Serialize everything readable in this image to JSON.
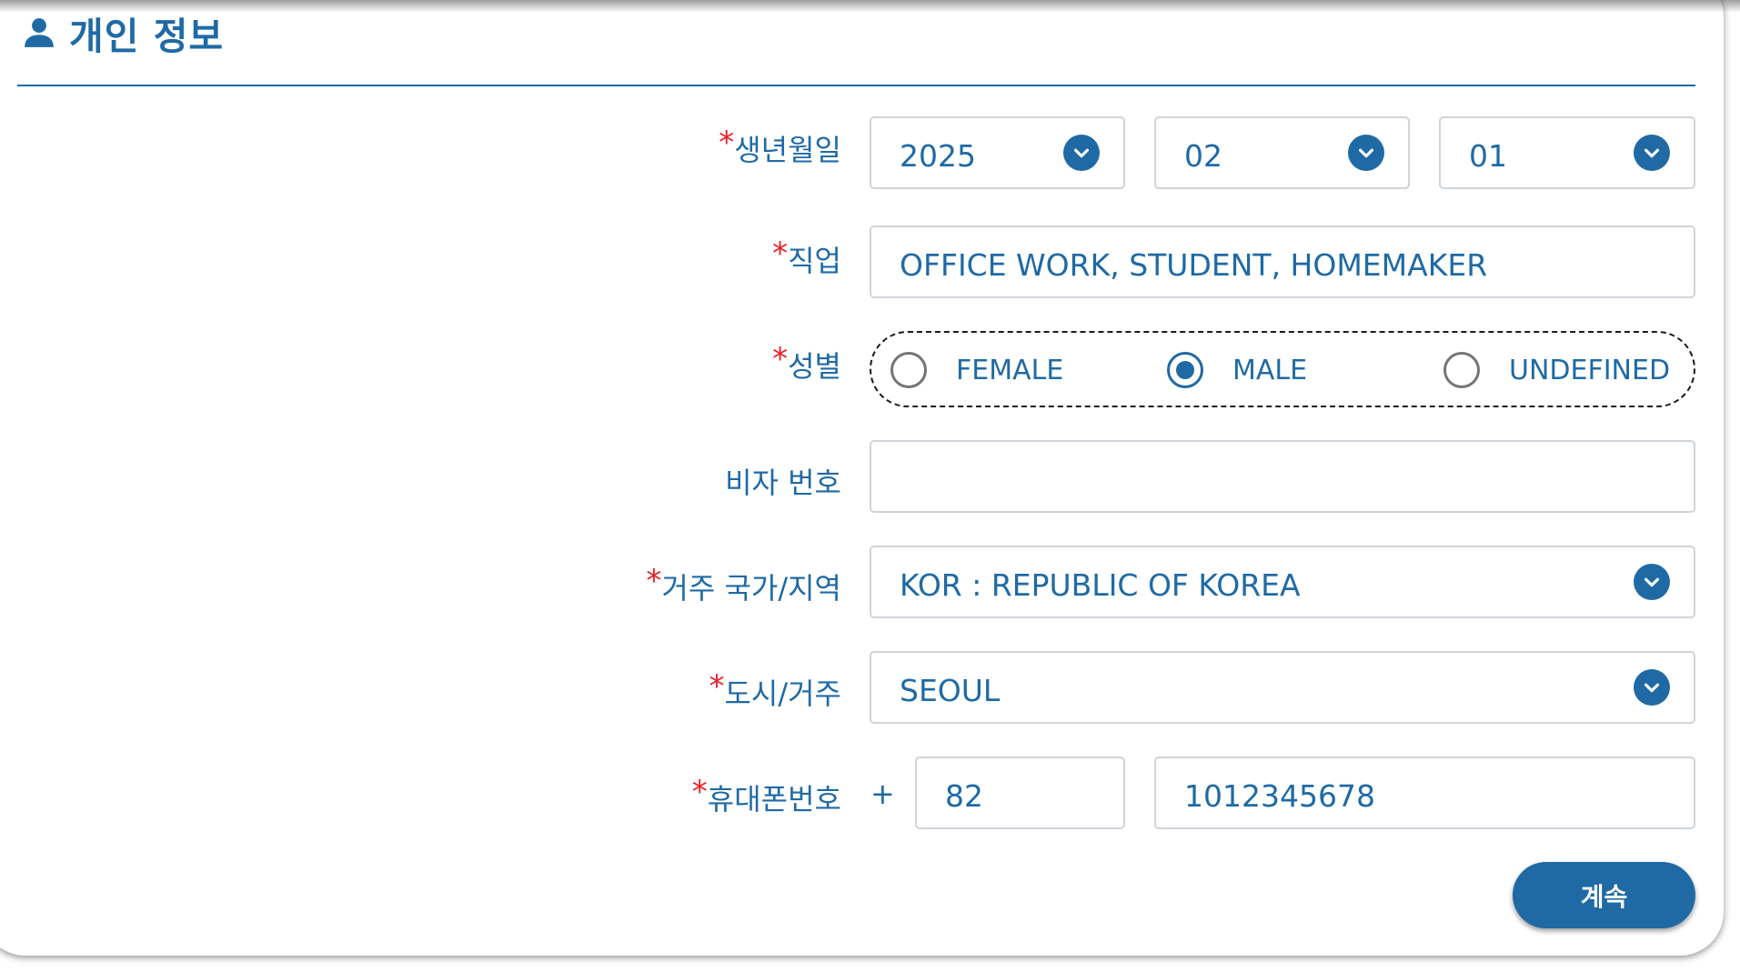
{
  "section": {
    "title": "개인 정보",
    "icon": "person-icon"
  },
  "birthdate": {
    "label": "생년월일",
    "required_mark": "*",
    "year": "2025",
    "month": "02",
    "day": "01"
  },
  "occupation": {
    "label": "직업",
    "required_mark": "*",
    "value": "OFFICE WORK, STUDENT, HOMEMAKER"
  },
  "gender": {
    "label": "성별",
    "required_mark": "*",
    "options": [
      "FEMALE",
      "MALE",
      "UNDEFINED"
    ],
    "selected": "MALE"
  },
  "visa": {
    "label": "비자 번호",
    "value": ""
  },
  "country": {
    "label": "거주 국가/지역",
    "required_mark": "*",
    "value": "KOR : REPUBLIC OF KOREA"
  },
  "city": {
    "label": "도시/거주",
    "required_mark": "*",
    "value": "SEOUL"
  },
  "phone": {
    "label": "휴대폰번호",
    "required_mark": "*",
    "plus": "+",
    "country_code": "82",
    "number": "1012345678"
  },
  "actions": {
    "continue_label": "계속"
  },
  "colors": {
    "accent": "#1f6aa5",
    "required": "#e8202a",
    "border": "#cfd4d9"
  }
}
